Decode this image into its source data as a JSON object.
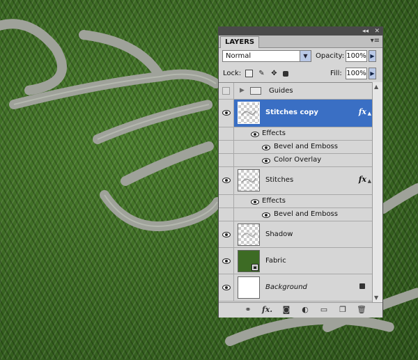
{
  "panel": {
    "title": "LAYERS",
    "top_controls": [
      "◂◂",
      "✕"
    ],
    "menu_icon": "panel-menu-icon",
    "blend_mode": "Normal",
    "opacity_label": "Opacity:",
    "opacity_value": "100%",
    "lock_label": "Lock:",
    "fill_label": "Fill:",
    "fill_value": "100%"
  },
  "layers": [
    {
      "name": "Guides",
      "type": "group",
      "visible": false
    },
    {
      "name": "Stitches copy",
      "type": "layer",
      "visible": true,
      "selected": true,
      "fx": "fx",
      "effects_label": "Effects",
      "effects": [
        "Bevel and Emboss",
        "Color Overlay"
      ]
    },
    {
      "name": "Stitches",
      "type": "layer",
      "visible": true,
      "fx": "fx",
      "effects_label": "Effects",
      "effects": [
        "Bevel and Emboss"
      ]
    },
    {
      "name": "Shadow",
      "type": "layer",
      "visible": true
    },
    {
      "name": "Fabric",
      "type": "layer",
      "visible": true
    },
    {
      "name": "Background",
      "type": "background",
      "visible": true,
      "locked": true
    }
  ],
  "bottom_icons": [
    "link-icon",
    "fx-icon",
    "mask-icon",
    "adjustment-icon",
    "folder-icon",
    "new-layer-icon",
    "trash-icon"
  ],
  "bottom_fx_label": "fx.",
  "colors": {
    "selection": "#3a6fc4",
    "panel_bg": "#d6d6d6",
    "fabric_green": "#3d6b24"
  }
}
